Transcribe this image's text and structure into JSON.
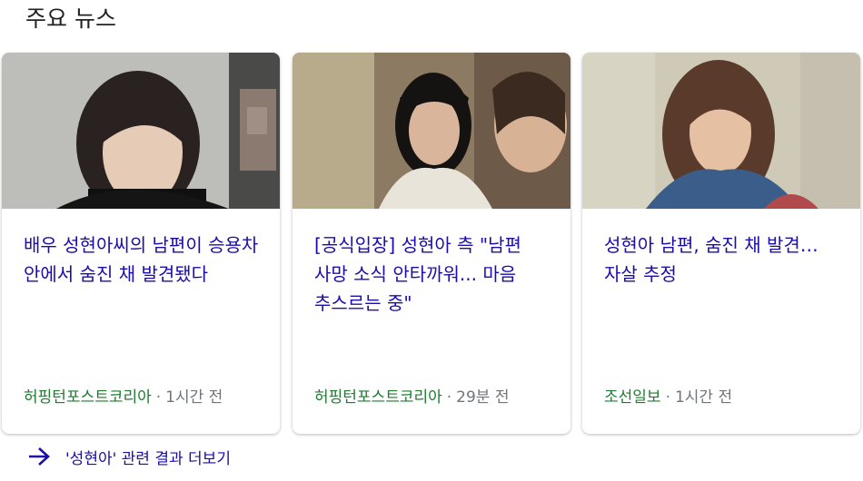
{
  "section": {
    "title": "주요 뉴스"
  },
  "cards": [
    {
      "headline": "배우 성현아씨의 남편이 승용차 안에서 숨진 채 발견됐다",
      "source": "허핑턴포스트코리아",
      "separator": "·",
      "time": "1시간 전"
    },
    {
      "headline": "[공식입장] 성현아 측 \"남편 사망 소식 안타까워... 마음 추스르는 중\"",
      "source": "허핑턴포스트코리아",
      "separator": "·",
      "time": "29분 전"
    },
    {
      "headline": "성현아 남편, 숨진 채 발견…자살 추정",
      "source": "조선일보",
      "separator": "·",
      "time": "1시간 전"
    }
  ],
  "more": {
    "label": "'성현아' 관련 결과 더보기",
    "icon": "arrow-right-icon"
  },
  "colors": {
    "link": "#1a0dab",
    "source": "#1e7b2f",
    "meta": "#70757a",
    "title": "#222222"
  }
}
